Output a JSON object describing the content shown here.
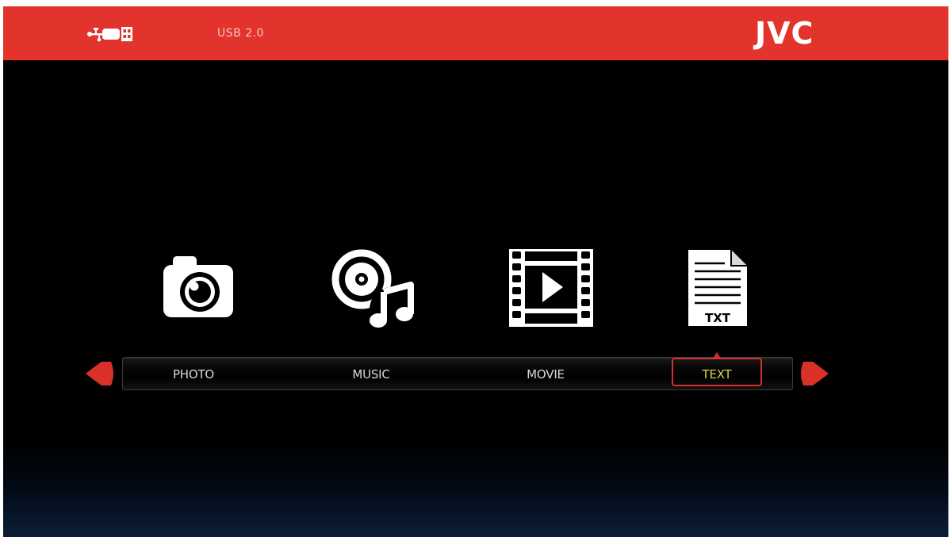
{
  "header": {
    "usb_label": "USB 2.0",
    "brand": "JVC",
    "background_color": "#e2332d"
  },
  "media_menu": {
    "items": [
      {
        "label": "PHOTO",
        "icon": "camera-icon"
      },
      {
        "label": "MUSIC",
        "icon": "music-disc-icon"
      },
      {
        "label": "MOVIE",
        "icon": "film-play-icon"
      },
      {
        "label": "TEXT",
        "icon": "txt-file-icon",
        "icon_text": "TXT"
      }
    ],
    "selected_index": 3,
    "selected_color": "#dcd64a",
    "highlight_color": "#d3322b",
    "arrow_color": "#d9302a"
  }
}
